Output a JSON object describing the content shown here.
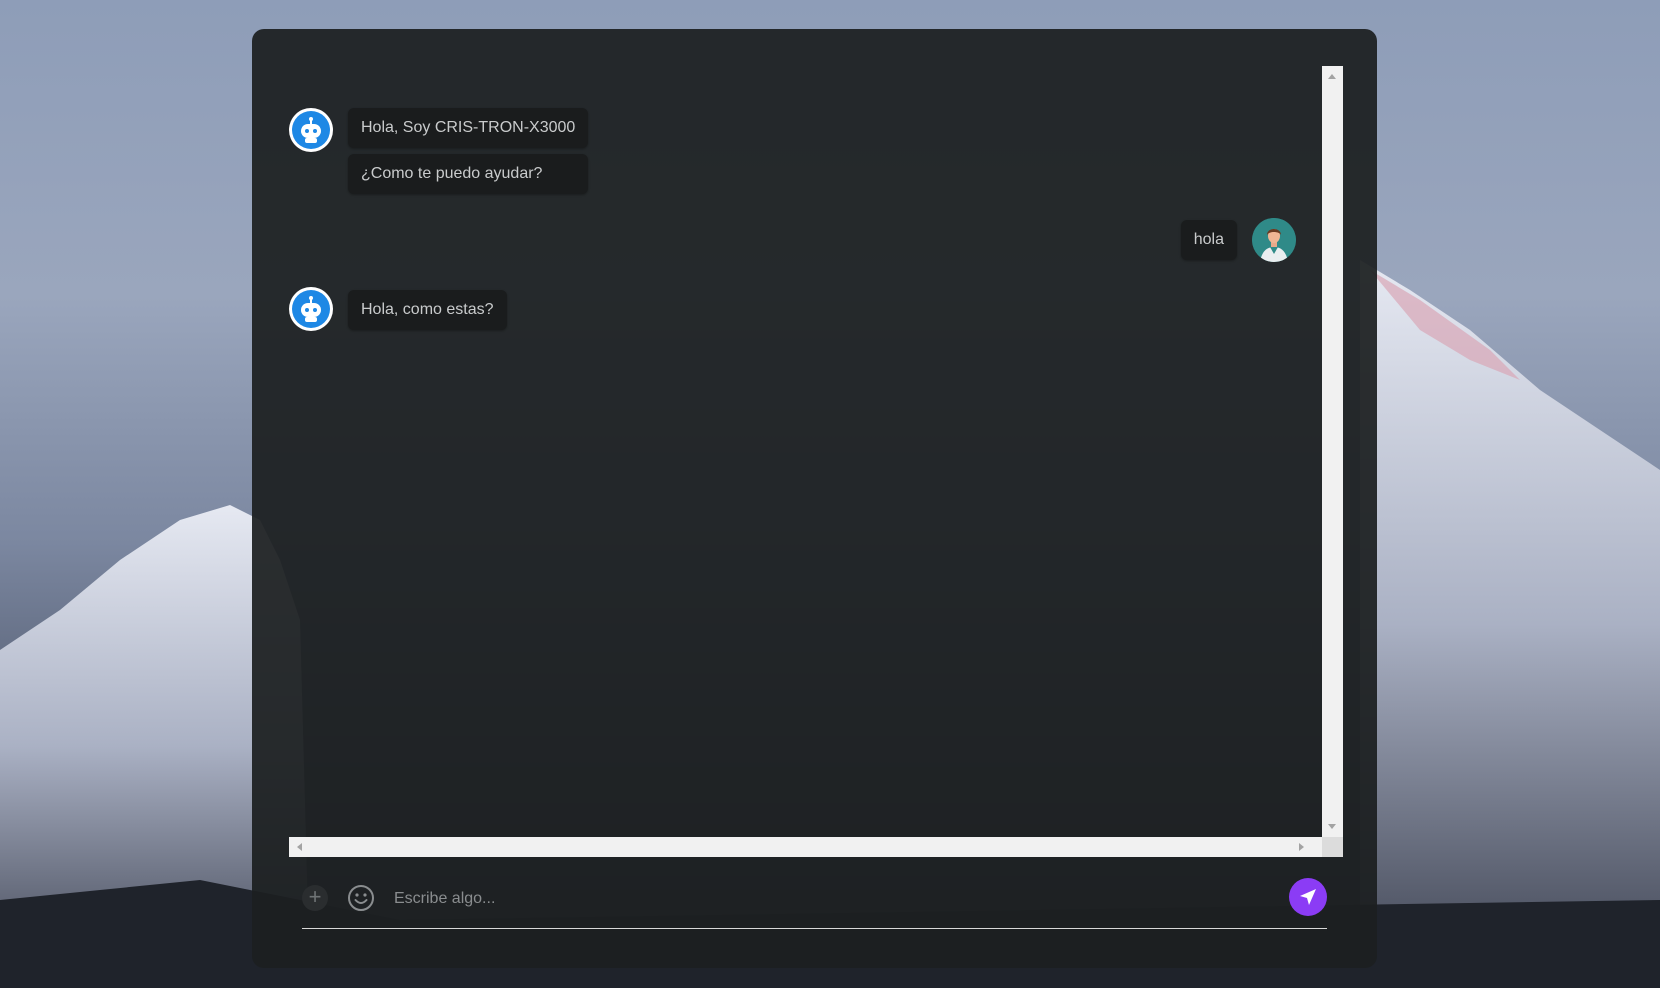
{
  "chat": {
    "messages": [
      {
        "sender": "bot",
        "lines": [
          "Hola, Soy CRIS-TRON-X3000",
          "¿Como te puedo ayudar?"
        ]
      },
      {
        "sender": "user",
        "lines": [
          "hola"
        ]
      },
      {
        "sender": "bot",
        "lines": [
          "Hola, como estas?"
        ]
      }
    ]
  },
  "composer": {
    "placeholder": "Escribe algo...",
    "plus_icon": "plus-icon",
    "emoji_icon": "smiley-icon",
    "send_icon": "send-icon"
  },
  "colors": {
    "panel": "#1c1f20",
    "bubble": "#1a1c1d",
    "send_button": "#8b3cf5",
    "bot_avatar": "#1e88e5",
    "user_avatar": "#2f8a88"
  }
}
